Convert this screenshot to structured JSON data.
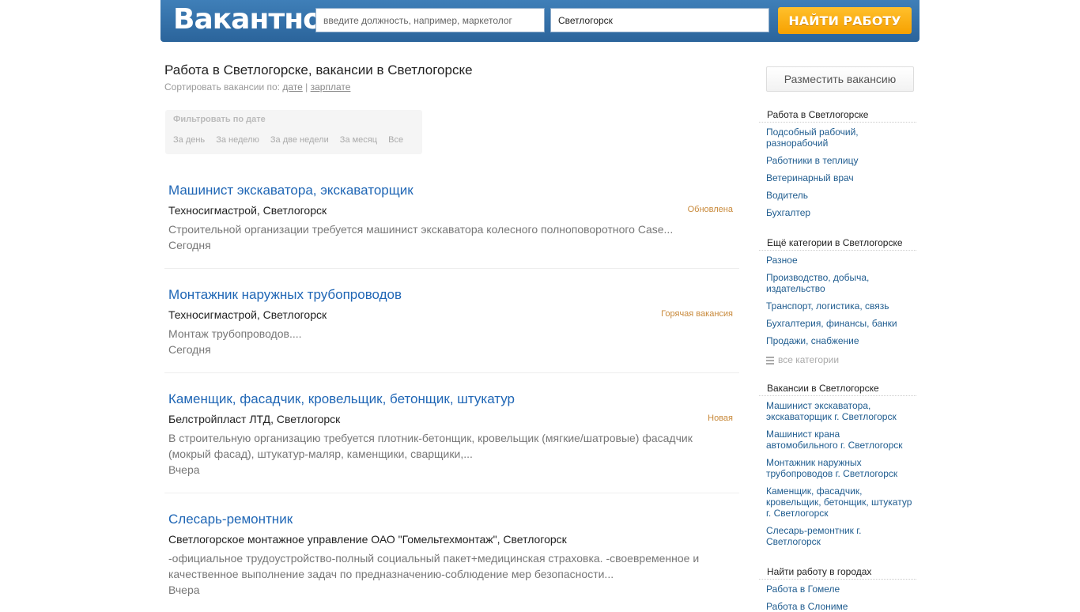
{
  "header": {
    "logo": "Вакантно",
    "search_placeholder": "введите должность, например, маркетолог",
    "city_value": "Светлогорск",
    "find_button": "НАЙТИ РАБОТУ"
  },
  "main": {
    "title": "Работа в Светлогорске, вакансии в Светлогорске",
    "sort_prefix": "Сортировать вакансии по:",
    "sort_date": "дате",
    "sort_separator": "|",
    "sort_salary": "зарплате",
    "filter": {
      "title": "Фильтровать по дате",
      "options": [
        "За день",
        "За неделю",
        "За две недели",
        "За месяц",
        "Все"
      ]
    },
    "vacancies": [
      {
        "title": "Машинист экскаватора, экскаваторщик",
        "company": "Техносигмастрой, Светлогорск",
        "badge": "Обновлена",
        "desc": "Строительной организации требуется машинист экскаватора колесного полноповоротного Case...",
        "date": "Сегодня"
      },
      {
        "title": "Монтажник наружных трубопроводов",
        "company": "Техносигмастрой, Светлогорск",
        "badge": "Горячая вакансия",
        "desc": "Монтаж трубопроводов....",
        "date": "Сегодня"
      },
      {
        "title": "Каменщик, фасадчик, кровельщик, бетонщик, штукатур",
        "company": "Белстройпласт ЛТД, Светлогорск",
        "badge": "Новая",
        "desc": "В строительную организацию требуется плотник-бетонщик, кровельщик (мягкие/шатровые) фасадчик (мокрый фасад), штукатур-маляр, каменщики, сварщики,...",
        "date": "Вчера"
      },
      {
        "title": "Слесарь-ремонтник",
        "company": "Светлогорское монтажное управление ОАО \"Гомельтехмонтаж\", Светлогорск",
        "badge": "",
        "desc": "-официальное трудоустройство-полный социальный пакет+медицинская страховка. -своевременное и качественное выполнение задач по предназначению-соблюдение мер безопасности...",
        "date": "Вчера"
      }
    ]
  },
  "sidebar": {
    "post_button": "Разместить вакансию",
    "jobs_heading": "Работа в Светлогорске",
    "jobs": [
      "Подсобный рабочий, разнорабочий",
      "Работники в теплицу",
      "Ветеринарный врач",
      "Водитель",
      "Бухгалтер"
    ],
    "cats_heading": "Ещё категории в Светлогорске",
    "cats": [
      "Разное",
      "Производство, добыча, издательство",
      "Транспорт, логистика, связь",
      "Бухгалтерия, финансы, банки",
      "Продажи, снабжение"
    ],
    "all_cats": "все категории",
    "vac_heading": "Вакансии в Светлогорске",
    "vacs": [
      "Машинист экскаватора, экскаваторщик г. Светлогорск",
      "Машинист крана автомобильного г. Светлогорск",
      "Монтажник наружных трубопроводов г. Светлогорск",
      "Каменщик, фасадчик, кровельщик, бетонщик, штукатур г. Светлогорск",
      "Слесарь-ремонтник г. Светлогорск"
    ],
    "cities_heading": "Найти работу в городах",
    "cities": [
      "Работа в Гомеле",
      "Работа в Слониме"
    ]
  }
}
